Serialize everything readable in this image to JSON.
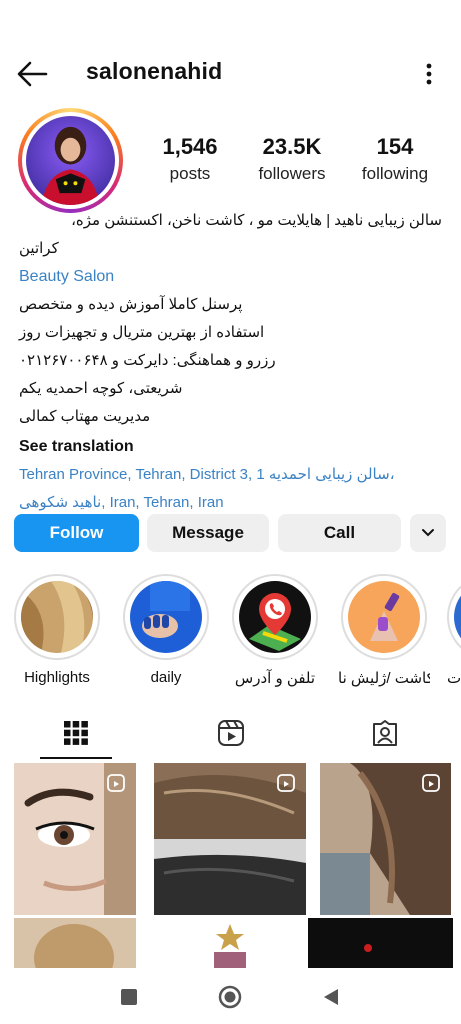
{
  "header": {
    "username": "salonenahid"
  },
  "stats": {
    "posts_count": "1,546",
    "posts_label": "posts",
    "followers_count": "23.5K",
    "followers_label": "followers",
    "following_count": "154",
    "following_label": "following"
  },
  "bio": {
    "line1": "سالن زیبایی ناهید | هایلایت مو ، کاشت ناخن، اکستنشن مژه،",
    "line2": "کراتین",
    "category": "Beauty Salon",
    "line3": "پرسنل کاملا آموزش دیده و متخصص",
    "line4": "استفاده از بهترین متریال و تجهیزات روز",
    "line5": "رزرو و هماهنگی: دایرکت و ۰۲۱۲۶۷۰۰۶۴۸",
    "line6": "شریعتی، کوچه احمدیه یکم",
    "line7": "مدیریت مهتاب کمالی",
    "see_translation": "See translation",
    "location_line1": "Tehran Province, Tehran, District 3, سالن زیبایی احمدیه 1،",
    "location_line2": "ناهید شکوهی, Iran, Tehran, Iran"
  },
  "actions": {
    "follow": "Follow",
    "message": "Message",
    "call": "Call"
  },
  "highlights": [
    {
      "label": "Highlights"
    },
    {
      "label": "daily"
    },
    {
      "label": "تلفن و آدرس"
    },
    {
      "label": "کاشت /ژلیش نا..."
    },
    {
      "label": "ت"
    }
  ],
  "colors": {
    "follow_button": "#1795f0",
    "link_blue": "#3b82c4"
  }
}
